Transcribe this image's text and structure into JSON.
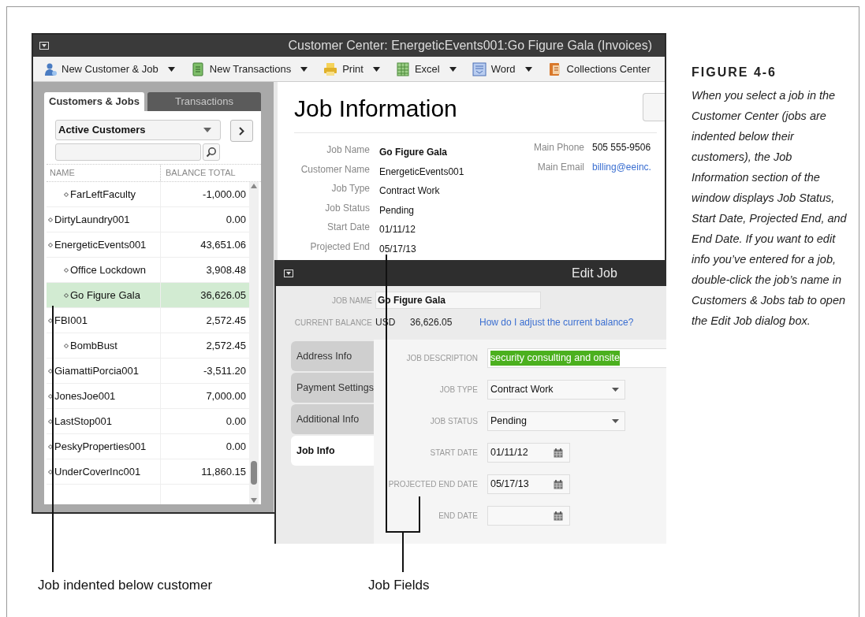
{
  "customer_center": {
    "title": "Customer Center: EnergeticEvents001:Go Figure Gala (Invoices)",
    "toolbar": [
      {
        "label": "New Customer & Job",
        "menu": true
      },
      {
        "label": "New Transactions",
        "menu": true
      },
      {
        "label": "Print",
        "menu": true
      },
      {
        "label": "Excel",
        "menu": true
      },
      {
        "label": "Word",
        "menu": true
      },
      {
        "label": "Collections Center",
        "menu": false
      }
    ],
    "tabs": [
      {
        "label": "Customers & Jobs",
        "selected": true
      },
      {
        "label": "Transactions",
        "selected": false
      }
    ],
    "filter": "Active Customers",
    "columns": [
      "NAME",
      "BALANCE TOTAL"
    ],
    "rows": [
      {
        "children": [
          {
            "name": "FarLeftFaculty",
            "balance": "-1,000.00",
            "selected": false
          }
        ]
      },
      {
        "name": "DirtyLaundry001",
        "balance": "0.00",
        "selected": false
      },
      {
        "name": "EnergeticEvents001",
        "balance": "43,651.06",
        "selected": false,
        "children": [
          {
            "name": "Office Lockdown",
            "balance": "3,908.48",
            "selected": false
          },
          {
            "name": "Go Figure Gala",
            "balance": "36,626.05",
            "selected": true
          }
        ]
      },
      {
        "name": "FBI001",
        "balance": "2,572.45",
        "selected": false,
        "children": [
          {
            "name": "BombBust",
            "balance": "2,572.45",
            "selected": false
          }
        ]
      },
      {
        "name": "GiamattiPorcia001",
        "balance": "-3,511.20",
        "selected": false
      },
      {
        "name": "JonesJoe001",
        "balance": "7,000.00",
        "selected": false
      },
      {
        "name": "LastStop001",
        "balance": "0.00",
        "selected": false
      },
      {
        "name": "PeskyProperties001",
        "balance": "0.00",
        "selected": false
      },
      {
        "name": "UnderCoverInc001",
        "balance": "11,860.15",
        "selected": false
      }
    ],
    "job_information": {
      "heading": "Job Information",
      "fields": [
        {
          "label": "Job Name",
          "value": "Go Figure Gala"
        },
        {
          "label": "Customer Name",
          "value": "EnergeticEvents001"
        },
        {
          "label": "Job Type",
          "value": "Contract Work"
        },
        {
          "label": "Job Status",
          "value": "Pending"
        },
        {
          "label": "Start Date",
          "value": "01/11/12"
        },
        {
          "label": "Projected End",
          "value": "05/17/13"
        }
      ],
      "contact": [
        {
          "label": "Main Phone",
          "value": "505 555-9506",
          "kind": "text"
        },
        {
          "label": "Main Email",
          "value": "billing@eeinc.",
          "kind": "link"
        }
      ]
    }
  },
  "edit_job": {
    "title": "Edit Job",
    "job_name_label": "JOB NAME",
    "job_name": "Go Figure Gala",
    "balance_label": "CURRENT BALANCE",
    "currency": "USD",
    "balance": "36,626.05",
    "help_link": "How do I adjust the current balance?",
    "tabs": [
      {
        "label": "Address Info",
        "selected": false
      },
      {
        "label": "Payment Settings",
        "selected": false
      },
      {
        "label": "Additional Info",
        "selected": false
      },
      {
        "label": "Job Info",
        "selected": true
      }
    ],
    "fields": [
      {
        "label": "JOB DESCRIPTION",
        "kind": "text",
        "value": "security consulting and onsite",
        "highlighted": true
      },
      {
        "label": "JOB TYPE",
        "kind": "dropdown",
        "value": "Contract Work"
      },
      {
        "label": "JOB STATUS",
        "kind": "dropdown",
        "value": "Pending"
      },
      {
        "label": "START DATE",
        "kind": "date",
        "value": "01/11/12"
      },
      {
        "label": "PROJECTED END DATE",
        "kind": "date",
        "value": "05/17/13"
      },
      {
        "label": "END DATE",
        "kind": "date"
      }
    ]
  },
  "caption": {
    "figure": "FIGURE 4-6",
    "text": "When you select a job in the Customer Center (jobs are indented below their customers), the Job Information section of the window displays Job Status, Start Date, Projected End, and End Date. If you want to edit info you’ve entered for a job, double-click the job’s name in Customers & Jobs tab to open the Edit Job dialog box."
  },
  "callouts": [
    "Job indented below customer",
    "Job Fields"
  ]
}
